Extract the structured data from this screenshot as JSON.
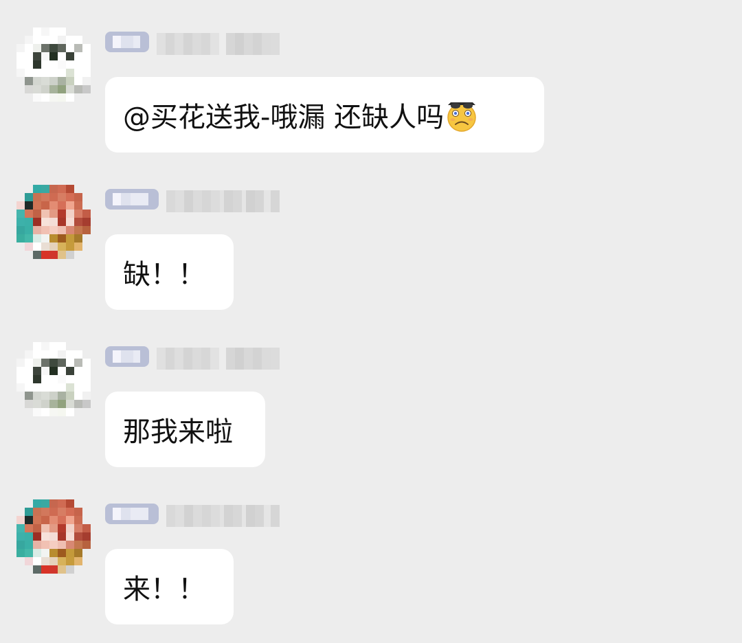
{
  "chat": {
    "messages": [
      {
        "sender": "user-a",
        "text": "@买花送我-哦漏 还缺人吗",
        "emoji": "worried-face-with-sunglasses-on-head-emoji"
      },
      {
        "sender": "user-b",
        "text": "缺！！"
      },
      {
        "sender": "user-a",
        "text": "那我来啦"
      },
      {
        "sender": "user-b",
        "text": "来！！"
      }
    ]
  },
  "colors": {
    "background": "#ededed",
    "bubble": "#ffffff",
    "tag": "#b9bfd6",
    "text": "#111111"
  }
}
